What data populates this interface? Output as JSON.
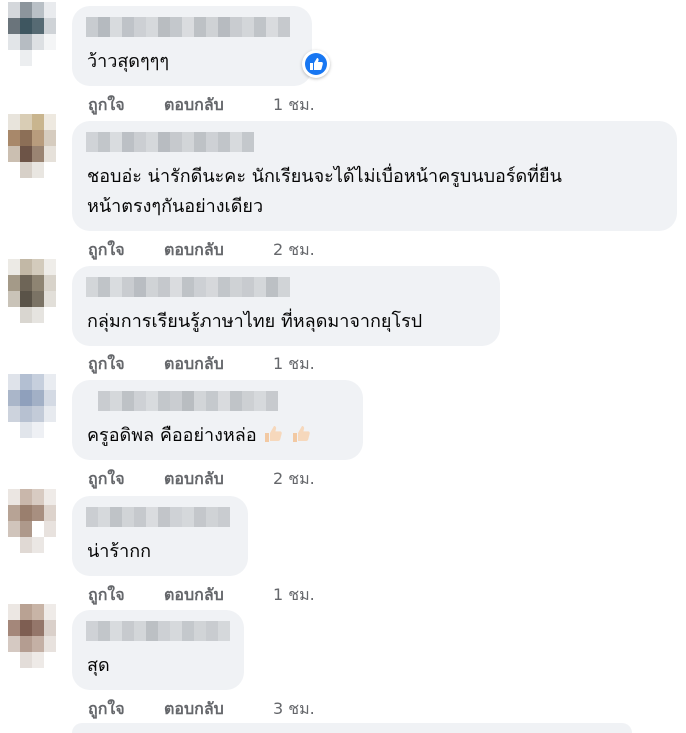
{
  "actions": {
    "like": "ถูกใจ",
    "reply": "ตอบกลับ"
  },
  "comments": [
    {
      "lines": [
        "ว้าวสุดๆๆๆ"
      ],
      "time": "1 ชม.",
      "reaction": "like"
    },
    {
      "lines": [
        "ชอบอ่ะ น่ารักดีนะคะ นักเรียนจะได้ไม่เบื่อหน้าครูบนบอร์ดที่ยืน",
        "หน้าตรงๆกันอย่างเดียว"
      ],
      "time": "2 ชม."
    },
    {
      "lines": [
        "กลุ่มการเรียนรู้ภาษาไทย ที่หลุดมาจากยุโรป"
      ],
      "time": "1 ชม."
    },
    {
      "lines": [
        "ครูอดิพล คืออย่างหล่อ"
      ],
      "time": "2 ชม.",
      "emoji": [
        "thumbs-up-icon",
        "thumbs-up-icon"
      ]
    },
    {
      "lines": [
        "น่าร้ากก"
      ],
      "time": "1 ชม."
    },
    {
      "lines": [
        "สุด"
      ],
      "time": "3 ชม."
    }
  ],
  "colors": {
    "bubble": "#f0f2f5",
    "action_text": "#65676b",
    "like_blue": "#1877f2"
  }
}
